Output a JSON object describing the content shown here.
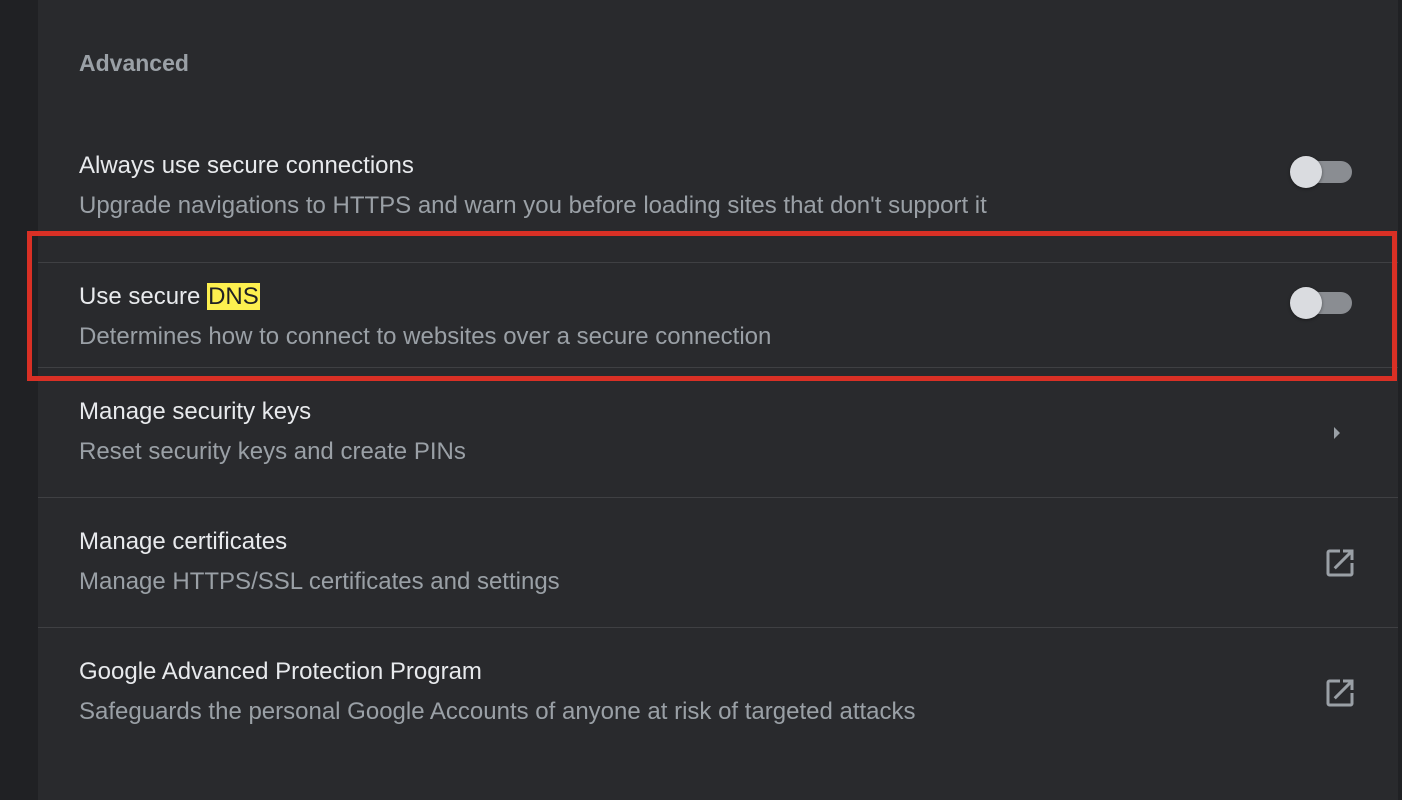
{
  "section": {
    "title": "Advanced"
  },
  "rows": [
    {
      "title": "Always use secure connections",
      "subtitle": "Upgrade navigations to HTTPS and warn you before loading sites that don't support it",
      "control": "toggle",
      "enabled": false
    },
    {
      "title_prefix": "Use secure ",
      "title_highlight": "DNS",
      "subtitle": "Determines how to connect to websites over a secure connection",
      "control": "toggle",
      "enabled": false
    },
    {
      "title": "Manage security keys",
      "subtitle": "Reset security keys and create PINs",
      "control": "arrow-right-icon"
    },
    {
      "title": "Manage certificates",
      "subtitle": "Manage HTTPS/SSL certificates and settings",
      "control": "open-in-new-icon"
    },
    {
      "title": "Google Advanced Protection Program",
      "subtitle": "Safeguards the personal Google Accounts of anyone at risk of targeted attacks",
      "control": "open-in-new-icon"
    }
  ],
  "colors": {
    "page_background": "#202124",
    "card_background": "#292a2d",
    "primary_text": "#e8eaed",
    "secondary_text": "#9aa0a6",
    "search_highlight": "#fdf04f",
    "annotation_box": "#d93025",
    "toggle_off_track": "#8a8d92",
    "toggle_off_knob": "#dadce0"
  }
}
